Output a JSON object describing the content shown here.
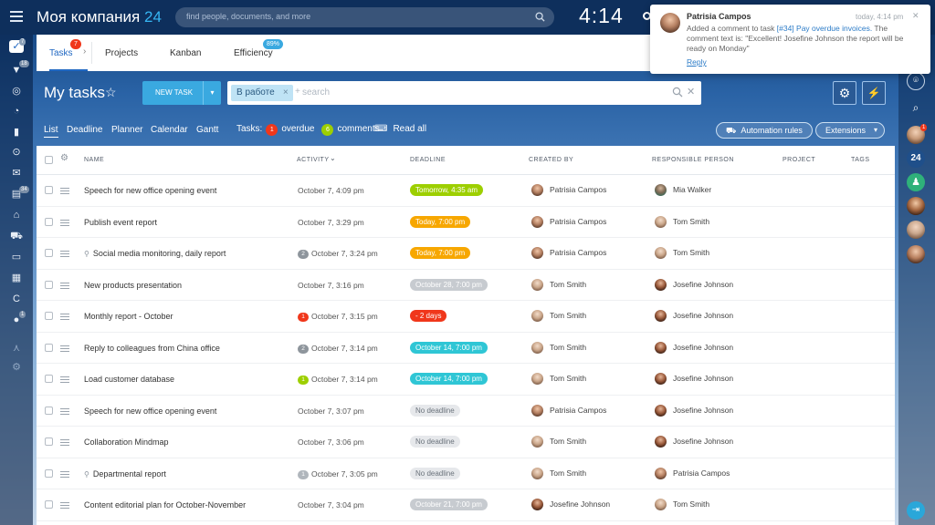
{
  "header": {
    "company_name": "Моя компания",
    "company_num": "24",
    "search_placeholder": "find people, documents, and more",
    "time": "4:14"
  },
  "tabs": [
    {
      "label": "Tasks",
      "badge": "7"
    },
    {
      "label": "Projects"
    },
    {
      "label": "Kanban"
    },
    {
      "label": "Efficiency",
      "badge": "89%"
    }
  ],
  "page": {
    "title": "My tasks",
    "new_task": "NEW TASK",
    "filter_chip": "В работе",
    "filter_placeholder": "search"
  },
  "subnav": {
    "views": [
      "List",
      "Deadline",
      "Planner",
      "Calendar",
      "Gantt"
    ],
    "tasks_label": "Tasks:",
    "overdue_count": "1",
    "overdue_label": "overdue",
    "comments_count": "6",
    "comments_label": "comments",
    "read_all": "Read all",
    "automation": "Automation rules",
    "extensions": "Extensions"
  },
  "columns": [
    "NAME",
    "ACTIVITY",
    "DEADLINE",
    "CREATED BY",
    "RESPONSIBLE PERSON",
    "PROJECT",
    "TAGS"
  ],
  "rows": [
    {
      "name": "Speech for new office opening event",
      "activity": "October 7, 4:09 pm",
      "deadline": "Tomorrow, 4:35 am",
      "created_by": "Patrisia Campos",
      "responsible": "Mia Walker"
    },
    {
      "name": "Publish event report",
      "activity": "October 7, 3:29 pm",
      "deadline": "Today, 7:00 pm",
      "created_by": "Patrisia Campos",
      "responsible": "Tom Smith"
    },
    {
      "name": "Social media monitoring, daily report",
      "activity": "October 7, 3:24 pm",
      "activity_badge": "2",
      "deadline": "Today, 7:00 pm",
      "created_by": "Patrisia Campos",
      "responsible": "Tom Smith"
    },
    {
      "name": "New products presentation",
      "activity": "October 7, 3:16 pm",
      "deadline": "October 28, 7:00 pm",
      "created_by": "Tom Smith",
      "responsible": "Josefine Johnson"
    },
    {
      "name": "Monthly report - October",
      "activity": "October 7, 3:15 pm",
      "activity_badge": "1",
      "deadline": "- 2 days",
      "created_by": "Tom Smith",
      "responsible": "Josefine Johnson"
    },
    {
      "name": "Reply to colleagues from China office",
      "activity": "October 7, 3:14 pm",
      "activity_badge": "2",
      "deadline": "October 14, 7:00 pm",
      "created_by": "Tom Smith",
      "responsible": "Josefine Johnson"
    },
    {
      "name": "Load customer database",
      "activity": "October 7, 3:14 pm",
      "activity_badge": "1",
      "deadline": "October 14, 7:00 pm",
      "created_by": "Tom Smith",
      "responsible": "Josefine Johnson"
    },
    {
      "name": "Speech for new office opening event",
      "activity": "October 7, 3:07 pm",
      "deadline": "No deadline",
      "created_by": "Patrisia Campos",
      "responsible": "Josefine Johnson"
    },
    {
      "name": "Collaboration Mindmap",
      "activity": "October 7, 3:06 pm",
      "deadline": "No deadline",
      "created_by": "Tom Smith",
      "responsible": "Josefine Johnson"
    },
    {
      "name": "Departmental report",
      "activity": "October 7, 3:05 pm",
      "activity_badge": "1",
      "deadline": "No deadline",
      "created_by": "Tom Smith",
      "responsible": "Patrisia Campos"
    },
    {
      "name": "Content editorial plan for October-November",
      "activity": "October 7, 3:04 pm",
      "deadline": "October 21, 7:00 pm",
      "created_by": "Josefine Johnson",
      "responsible": "Tom Smith"
    }
  ],
  "notification": {
    "author": "Patrisia Campos",
    "time": "today, 4:14 pm",
    "text_a": "Added a comment to task",
    "task_link": "[#34] Pay overdue invoices.",
    "text_b": "The comment text is: \"Excellent! Josefine Johnson  the report will be ready on Monday\"",
    "reply": "Reply"
  },
  "rail_badges": {
    "tasks": "7",
    "feed": "18",
    "mail": "34",
    "bottom": "1"
  },
  "right_rail": {
    "b24": "24",
    "badge": "1"
  },
  "colors": {
    "green": "#9dcf00",
    "orange": "#f7a700",
    "teal": "#2fc6d5",
    "gray": "#c7cbd0",
    "red": "#f0371b",
    "blue": "#3aa9e0"
  }
}
